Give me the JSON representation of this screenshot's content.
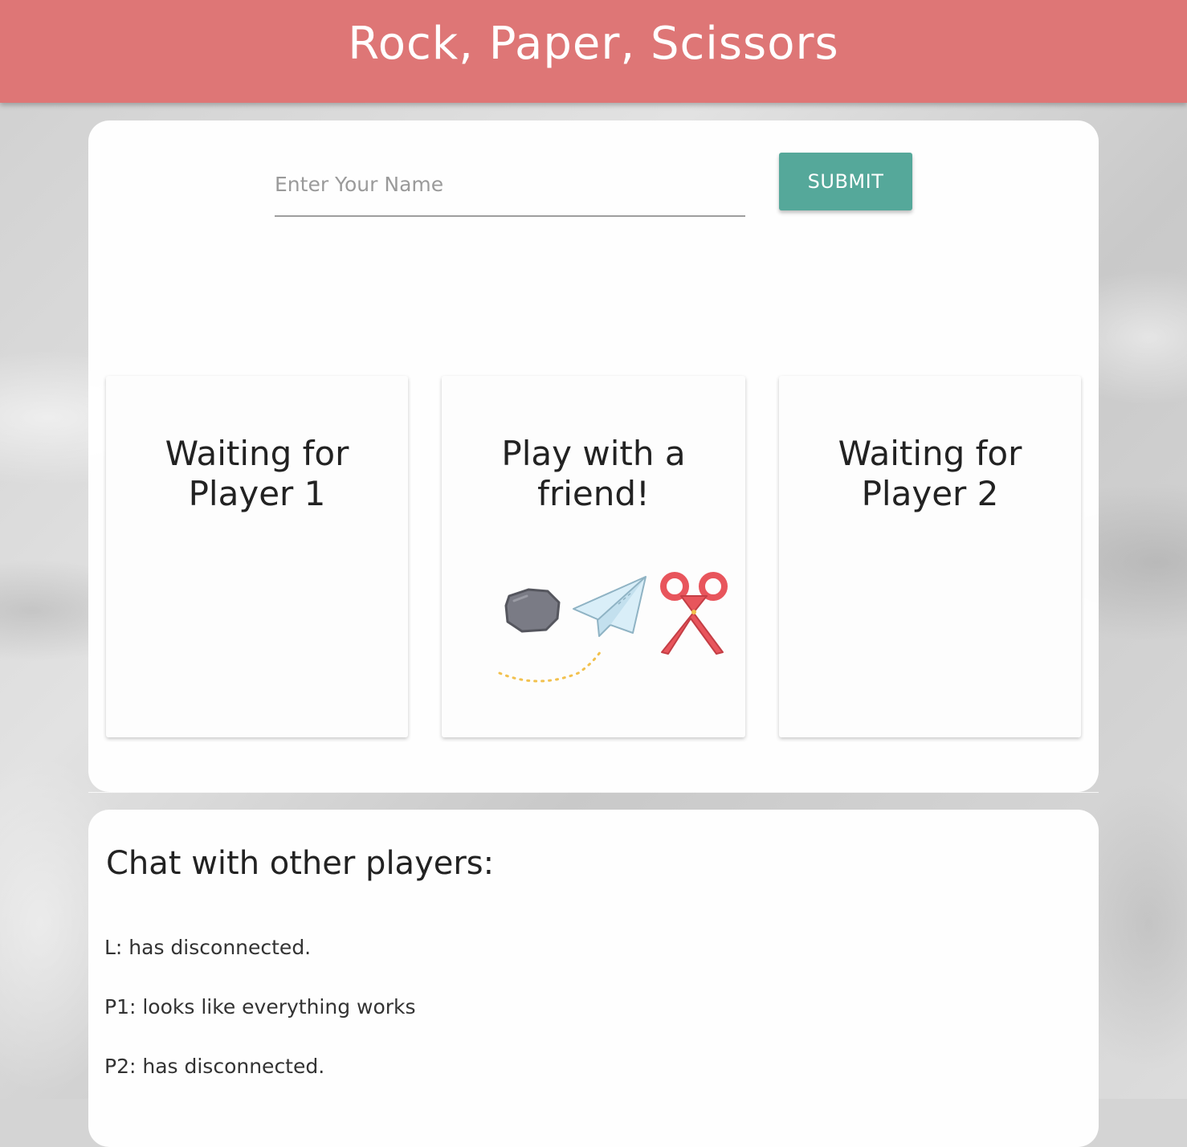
{
  "header": {
    "title": "Rock, Paper, Scissors"
  },
  "name_form": {
    "placeholder": "Enter Your Name",
    "value": "",
    "submit_label": "SUBMIT"
  },
  "cards": {
    "player1": {
      "title": "Waiting for Player 1"
    },
    "middle": {
      "title": "Play with a friend!",
      "art": [
        "rock-icon",
        "paper-airplane-icon",
        "scissors-icon"
      ]
    },
    "player2": {
      "title": "Waiting for Player 2"
    }
  },
  "chat": {
    "title": "Chat with other players:",
    "messages": [
      "L: has disconnected.",
      "P1: looks like everything works",
      "P2: has disconnected."
    ]
  },
  "colors": {
    "header": "#de7676",
    "submit": "#55a89a",
    "rock": "#7a7b85",
    "paper": "#d9eef8",
    "scissors": "#e8555c"
  }
}
